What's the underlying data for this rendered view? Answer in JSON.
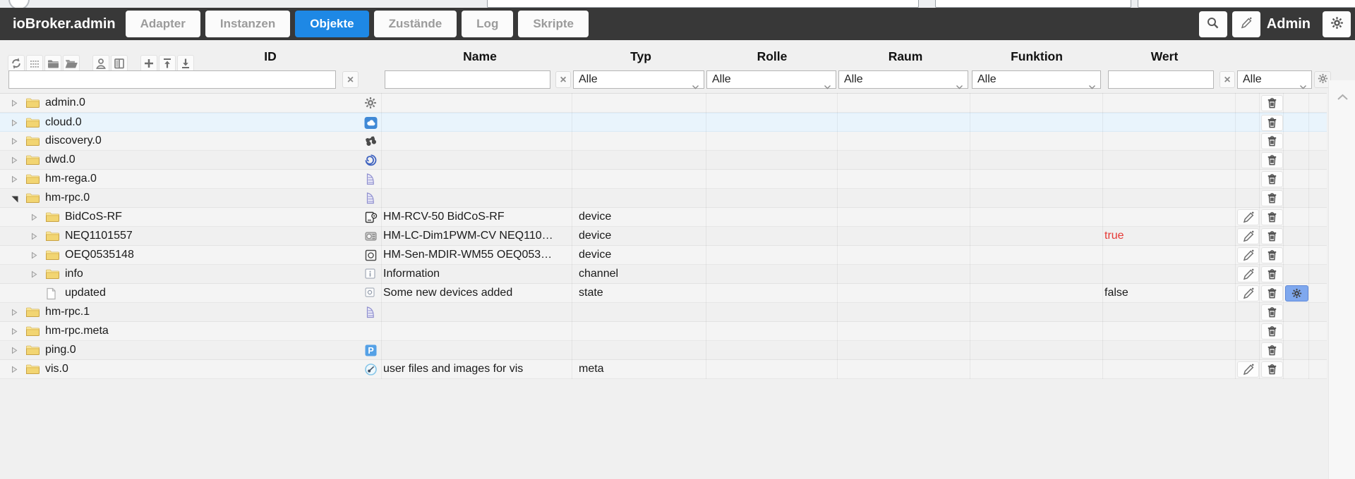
{
  "topbar": {
    "title": "ioBroker.admin",
    "tabs": [
      {
        "label": "Adapter",
        "active": false
      },
      {
        "label": "Instanzen",
        "active": false
      },
      {
        "label": "Objekte",
        "active": true
      },
      {
        "label": "Zustände",
        "active": false
      },
      {
        "label": "Log",
        "active": false
      },
      {
        "label": "Skripte",
        "active": false
      }
    ],
    "user_label": "Admin"
  },
  "toolbar": {
    "buttons": [
      {
        "name": "refresh-button",
        "icon": "refresh-icon",
        "group": 1
      },
      {
        "name": "list-view-button",
        "icon": "list-icon",
        "group": 1
      },
      {
        "name": "collapse-folders-button",
        "icon": "folder-collapse-icon",
        "group": 1
      },
      {
        "name": "expand-folders-button",
        "icon": "folder-expand-icon",
        "group": 1
      },
      {
        "name": "user-defaults-button",
        "icon": "user-icon",
        "group": 2
      },
      {
        "name": "columns-button",
        "icon": "book-icon",
        "group": 2
      },
      {
        "name": "add-object-button",
        "icon": "plus-icon",
        "group": 3
      },
      {
        "name": "collapse-all-button",
        "icon": "move-top-icon",
        "group": 3
      },
      {
        "name": "expand-all-button",
        "icon": "move-bottom-icon",
        "group": 3
      }
    ]
  },
  "columns": {
    "id": "ID",
    "name": "Name",
    "type": "Typ",
    "role": "Rolle",
    "room": "Raum",
    "function": "Funktion",
    "value": "Wert"
  },
  "filters": {
    "id": {
      "value": "",
      "clear": "×"
    },
    "name": {
      "value": "",
      "clear": "×"
    },
    "type": {
      "selected": "Alle"
    },
    "role": {
      "selected": "Alle"
    },
    "room": {
      "selected": "Alle"
    },
    "function": {
      "selected": "Alle"
    },
    "value": {
      "value": "",
      "clear": "×"
    },
    "custom": {
      "selected": "Alle"
    }
  },
  "tree": {
    "rows": [
      {
        "id": "admin.0",
        "level": 0,
        "expander": "collapsed",
        "tree_icon": "folder-icon",
        "type_icon": "admin-adapter-icon",
        "name": "",
        "type": "",
        "value": "",
        "value_color": "",
        "highlighted": false,
        "actions": [
          "delete"
        ]
      },
      {
        "id": "cloud.0",
        "level": 0,
        "expander": "collapsed",
        "tree_icon": "folder-icon",
        "type_icon": "cloud-adapter-icon",
        "name": "",
        "type": "",
        "value": "",
        "value_color": "",
        "highlighted": true,
        "actions": [
          "delete"
        ]
      },
      {
        "id": "discovery.0",
        "level": 0,
        "expander": "collapsed",
        "tree_icon": "folder-icon",
        "type_icon": "discovery-adapter-icon",
        "name": "",
        "type": "",
        "value": "",
        "value_color": "",
        "highlighted": false,
        "actions": [
          "delete"
        ]
      },
      {
        "id": "dwd.0",
        "level": 0,
        "expander": "collapsed",
        "tree_icon": "folder-icon",
        "type_icon": "dwd-adapter-icon",
        "name": "",
        "type": "",
        "value": "",
        "value_color": "",
        "highlighted": false,
        "actions": [
          "delete"
        ]
      },
      {
        "id": "hm-rega.0",
        "level": 0,
        "expander": "collapsed",
        "tree_icon": "folder-icon",
        "type_icon": "homematic-adapter-icon",
        "name": "",
        "type": "",
        "value": "",
        "value_color": "",
        "highlighted": false,
        "actions": [
          "delete"
        ]
      },
      {
        "id": "hm-rpc.0",
        "level": 0,
        "expander": "expanded",
        "tree_icon": "folder-icon",
        "type_icon": "homematic-adapter-icon",
        "name": "",
        "type": "",
        "value": "",
        "value_color": "",
        "highlighted": false,
        "actions": [
          "delete"
        ]
      },
      {
        "id": "BidCoS-RF",
        "level": 1,
        "expander": "collapsed",
        "tree_icon": "folder-icon",
        "type_icon": "device-icon",
        "name": "HM-RCV-50 BidCoS-RF",
        "type": "device",
        "value": "",
        "value_color": "",
        "highlighted": false,
        "actions": [
          "edit",
          "delete"
        ]
      },
      {
        "id": "NEQ1101557",
        "level": 1,
        "expander": "collapsed",
        "tree_icon": "folder-icon",
        "type_icon": "dimmer-device-icon",
        "name": "HM-LC-Dim1PWM-CV NEQ110…",
        "type": "device",
        "value": "true",
        "value_color": "#e53935",
        "highlighted": false,
        "actions": [
          "edit",
          "delete"
        ]
      },
      {
        "id": "OEQ0535148",
        "level": 1,
        "expander": "collapsed",
        "tree_icon": "folder-icon",
        "type_icon": "sensor-device-icon",
        "name": "HM-Sen-MDIR-WM55 OEQ053…",
        "type": "device",
        "value": "",
        "value_color": "",
        "highlighted": false,
        "actions": [
          "edit",
          "delete"
        ]
      },
      {
        "id": "info",
        "level": 1,
        "expander": "collapsed",
        "tree_icon": "folder-icon",
        "type_icon": "info-channel-icon",
        "name": "Information",
        "type": "channel",
        "value": "",
        "value_color": "",
        "highlighted": false,
        "actions": [
          "edit",
          "delete"
        ]
      },
      {
        "id": "updated",
        "level": 1,
        "expander": "none",
        "tree_icon": "document-icon",
        "type_icon": "state-icon",
        "name": "Some new devices added",
        "type": "state",
        "value": "false",
        "value_color": "",
        "highlighted": false,
        "actions": [
          "edit",
          "delete",
          "custom-settings"
        ]
      },
      {
        "id": "hm-rpc.1",
        "level": 0,
        "expander": "collapsed",
        "tree_icon": "folder-icon",
        "type_icon": "homematic-adapter-icon",
        "name": "",
        "type": "",
        "value": "",
        "value_color": "",
        "highlighted": false,
        "actions": [
          "delete"
        ]
      },
      {
        "id": "hm-rpc.meta",
        "level": 0,
        "expander": "collapsed",
        "tree_icon": "folder-icon",
        "type_icon": "none",
        "name": "",
        "type": "",
        "value": "",
        "value_color": "",
        "highlighted": false,
        "actions": [
          "delete"
        ]
      },
      {
        "id": "ping.0",
        "level": 0,
        "expander": "collapsed",
        "tree_icon": "folder-icon",
        "type_icon": "ping-adapter-icon",
        "name": "",
        "type": "",
        "value": "",
        "value_color": "",
        "highlighted": false,
        "actions": [
          "delete"
        ]
      },
      {
        "id": "vis.0",
        "level": 0,
        "expander": "collapsed",
        "tree_icon": "folder-icon",
        "type_icon": "vis-adapter-icon",
        "name": "user files and images for vis",
        "type": "meta",
        "value": "",
        "value_color": "",
        "highlighted": false,
        "actions": [
          "edit",
          "delete"
        ]
      }
    ]
  },
  "colors": {
    "accent": "#1e88e5",
    "topbar_bg": "#383838",
    "highlight_row": "#e9f4fc",
    "value_true": "#e53935",
    "custom_button_bg": "#7fa8ee"
  }
}
